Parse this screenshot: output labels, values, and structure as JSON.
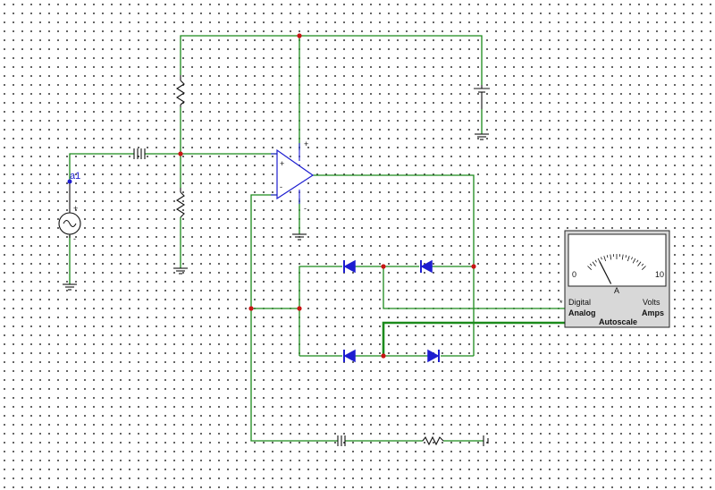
{
  "probe": {
    "label": "a1"
  },
  "meter": {
    "scale_min": "0",
    "scale_max": "10",
    "unit_label": "A",
    "mode_digital": "Digital",
    "mode_analog": "Analog",
    "mode_volts": "Volts",
    "mode_amps": "Amps",
    "autoscale": "Autoscale",
    "needle_fraction": 0.2
  },
  "opamp": {
    "plus_supply": "+",
    "minus_supply": "-",
    "noninv": "+",
    "inv": "-"
  },
  "source": {
    "plus": "+",
    "minus": "-"
  },
  "colors": {
    "wire": "#1b8a1b",
    "node": "#c81414",
    "component": "#1d1dd0",
    "meter_bg": "#d8d8d8"
  }
}
